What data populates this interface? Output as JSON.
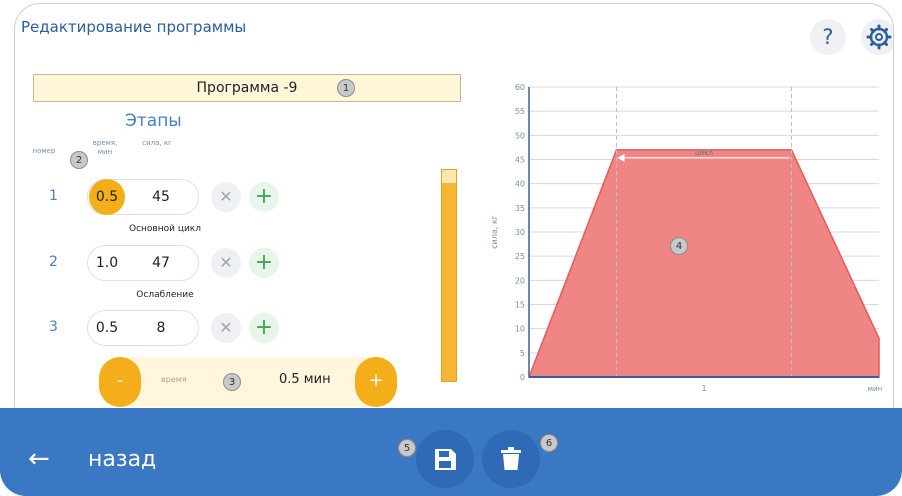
{
  "header": {
    "title": "Редактирование программы",
    "help_label": "?",
    "help_icon": "question-icon",
    "settings_icon": "gear-icon"
  },
  "program": {
    "name": "Программа -9"
  },
  "stages": {
    "title": "Этапы",
    "col_num": "номер",
    "col_time": "время, мин",
    "col_force": "сила, кг",
    "rows": [
      {
        "num": "1",
        "time": "0.5",
        "force": "45",
        "label": "Основной цикл",
        "active": true
      },
      {
        "num": "2",
        "time": "1.0",
        "force": "47",
        "label": "Ослабление",
        "active": false
      },
      {
        "num": "3",
        "time": "0.5",
        "force": "8",
        "label": "",
        "active": false
      }
    ],
    "remove_glyph": "✕",
    "add_glyph": "+"
  },
  "level_indicator": {
    "fill_fraction": 0.94
  },
  "stepper": {
    "minus": "-",
    "plus": "+",
    "label": "время",
    "value": "0.5 мин"
  },
  "markers": [
    "1",
    "2",
    "3",
    "4",
    "5",
    "6"
  ],
  "chart_data": {
    "type": "area",
    "ylabel": "сила, кг",
    "xlabel": "мин",
    "x_tick_labels": [
      "1"
    ],
    "y_ticks": [
      0,
      5,
      10,
      15,
      20,
      25,
      30,
      35,
      40,
      45,
      50,
      55,
      60
    ],
    "ylim": [
      0,
      60
    ],
    "xlim": [
      0,
      2
    ],
    "grid": true,
    "points": [
      [
        0,
        0
      ],
      [
        0.5,
        47
      ],
      [
        1.5,
        47
      ],
      [
        2.0,
        8
      ]
    ],
    "cycle_start_x": 0.5,
    "cycle_end_x": 1.5,
    "cycle_label": "цикл",
    "fill_color": "#ef8585",
    "line_color": "#e55a5a"
  },
  "footer": {
    "back_label": "назад",
    "back_arrow": "←",
    "save_icon": "save-icon",
    "delete_icon": "trash-icon"
  },
  "colors": {
    "accent": "#f3ae1a",
    "primary": "#3b78c4"
  }
}
